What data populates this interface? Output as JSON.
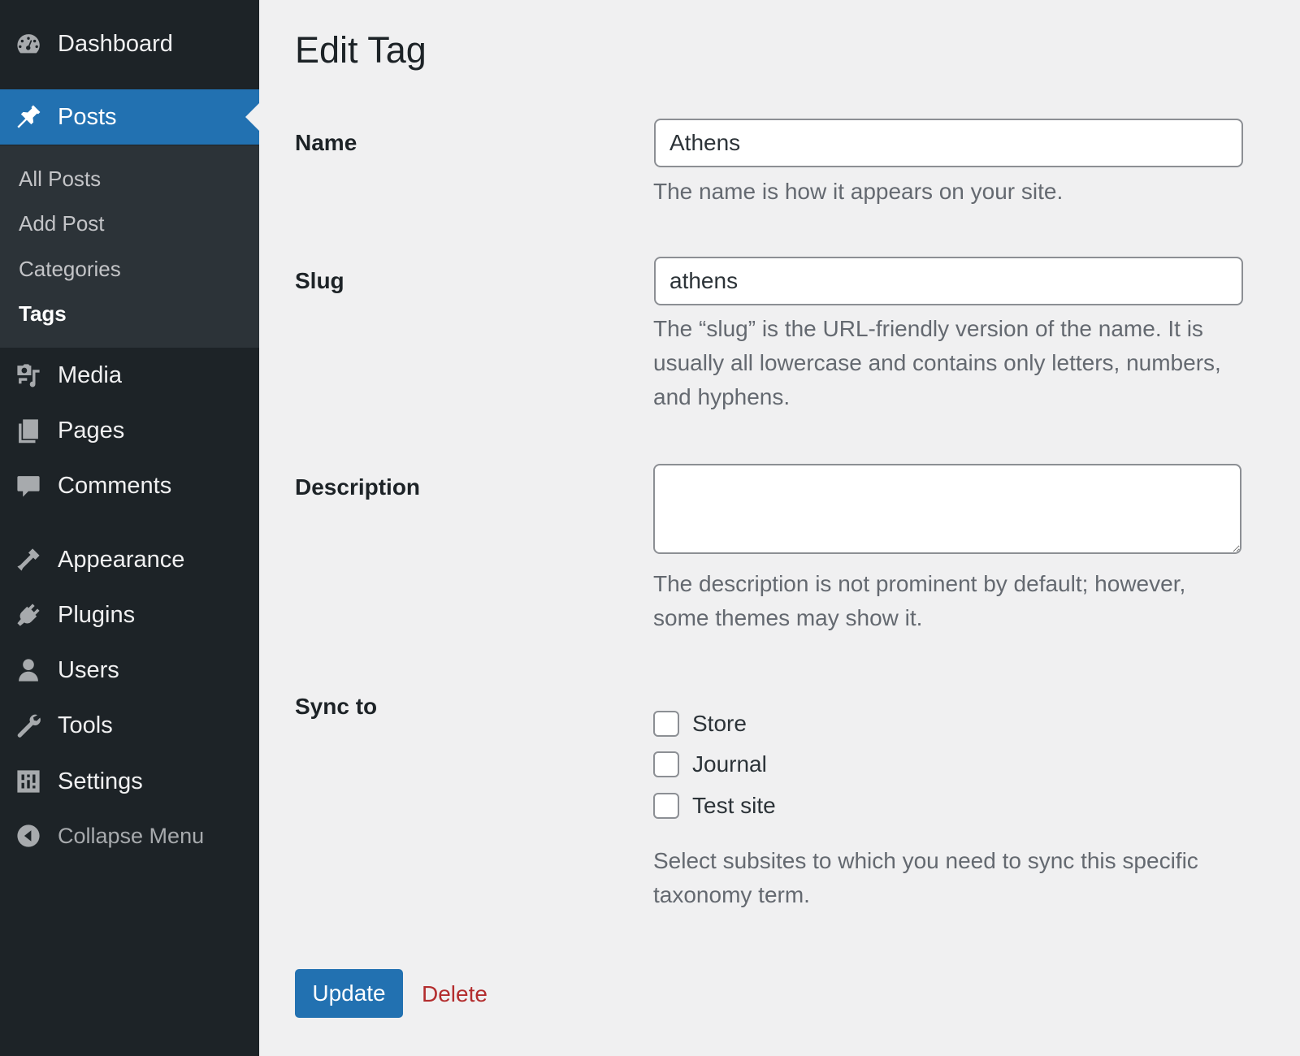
{
  "sidebar": {
    "items": [
      {
        "label": "Dashboard",
        "icon": "dashboard-icon"
      },
      {
        "label": "Posts",
        "icon": "pin-icon",
        "active": true
      },
      {
        "label": "Media",
        "icon": "media-icon"
      },
      {
        "label": "Pages",
        "icon": "pages-icon"
      },
      {
        "label": "Comments",
        "icon": "comments-icon"
      },
      {
        "label": "Appearance",
        "icon": "appearance-icon"
      },
      {
        "label": "Plugins",
        "icon": "plugins-icon"
      },
      {
        "label": "Users",
        "icon": "users-icon"
      },
      {
        "label": "Tools",
        "icon": "tools-icon"
      },
      {
        "label": "Settings",
        "icon": "settings-icon"
      },
      {
        "label": "Collapse Menu",
        "icon": "collapse-icon"
      }
    ],
    "submenu": [
      {
        "label": "All Posts"
      },
      {
        "label": "Add Post"
      },
      {
        "label": "Categories"
      },
      {
        "label": "Tags",
        "current": true
      }
    ]
  },
  "page": {
    "title": "Edit Tag",
    "name": {
      "label": "Name",
      "value": "Athens",
      "help": "The name is how it appears on your site."
    },
    "slug": {
      "label": "Slug",
      "value": "athens",
      "help": "The “slug” is the URL-friendly version of the name. It is usually all lowercase and contains only letters, numbers, and hyphens."
    },
    "description": {
      "label": "Description",
      "value": "",
      "help": "The description is not prominent by default; however, some themes may show it."
    },
    "sync": {
      "label": "Sync to",
      "options": [
        {
          "label": "Store",
          "checked": false
        },
        {
          "label": "Journal",
          "checked": false
        },
        {
          "label": "Test site",
          "checked": false
        }
      ],
      "help": "Select subsites to which you need to sync this specific taxonomy term."
    },
    "update_label": "Update",
    "delete_label": "Delete"
  },
  "colors": {
    "sidebar_bg": "#1d2327",
    "submenu_bg": "#2c3338",
    "accent": "#2271b1",
    "delete": "#b32d2e",
    "page_bg": "#f0f0f1"
  }
}
